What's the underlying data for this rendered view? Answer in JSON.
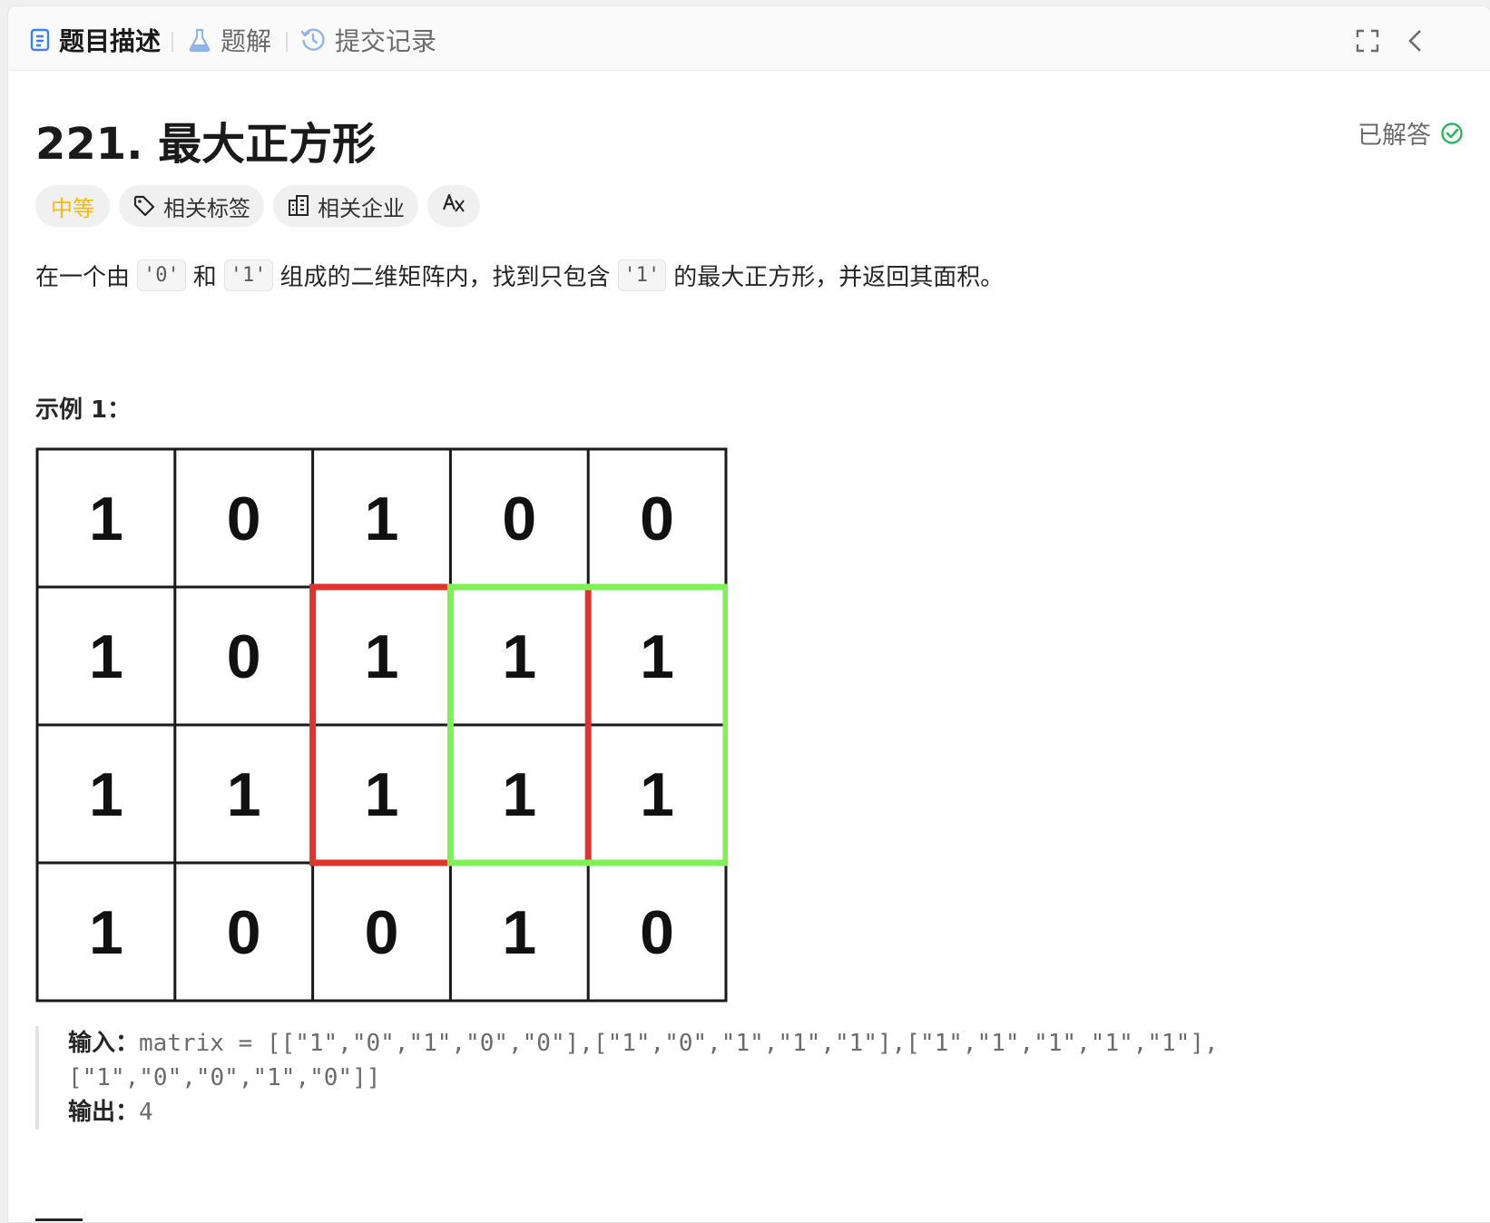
{
  "tabs": [
    {
      "label": "题目描述",
      "icon": "document-icon",
      "active": true
    },
    {
      "label": "题解",
      "icon": "flask-icon",
      "active": false
    },
    {
      "label": "提交记录",
      "icon": "history-icon",
      "active": false
    }
  ],
  "toolbar": {
    "fullscreen_icon": "fullscreen-icon",
    "collapse_icon": "chevron-left-icon"
  },
  "problem": {
    "title": "221. 最大正方形",
    "status": "已解答",
    "difficulty": "中等",
    "chips": {
      "tags": "相关标签",
      "companies": "相关企业"
    },
    "description": {
      "p1": "在一个由",
      "c1": "'0'",
      "p2": "和",
      "c2": "'1'",
      "p3": "组成的二维矩阵内，找到只包含",
      "c3": "'1'",
      "p4": "的最大正方形，并返回其面积。"
    }
  },
  "example": {
    "title": "示例 1：",
    "input_label": "输入：",
    "input_value_line1": "matrix = [[\"1\",\"0\",\"1\",\"0\",\"0\"],[\"1\",\"0\",\"1\",\"1\",\"1\"],[\"1\",\"1\",\"1\",\"1\",\"1\"],",
    "input_value_line2": "[\"1\",\"0\",\"0\",\"1\",\"0\"]]",
    "output_label": "输出：",
    "output_value": "4"
  },
  "matrix": [
    [
      "1",
      "0",
      "1",
      "0",
      "0"
    ],
    [
      "1",
      "0",
      "1",
      "1",
      "1"
    ],
    [
      "1",
      "1",
      "1",
      "1",
      "1"
    ],
    [
      "1",
      "0",
      "0",
      "1",
      "0"
    ]
  ],
  "highlights": [
    {
      "color": "#e0332b",
      "row": 1,
      "col": 2,
      "size": 2
    },
    {
      "color": "#7ef253",
      "row": 1,
      "col": 3,
      "size": 2
    }
  ],
  "colors": {
    "accent_difficulty": "#ffb800",
    "solved_check": "#2db55d"
  }
}
